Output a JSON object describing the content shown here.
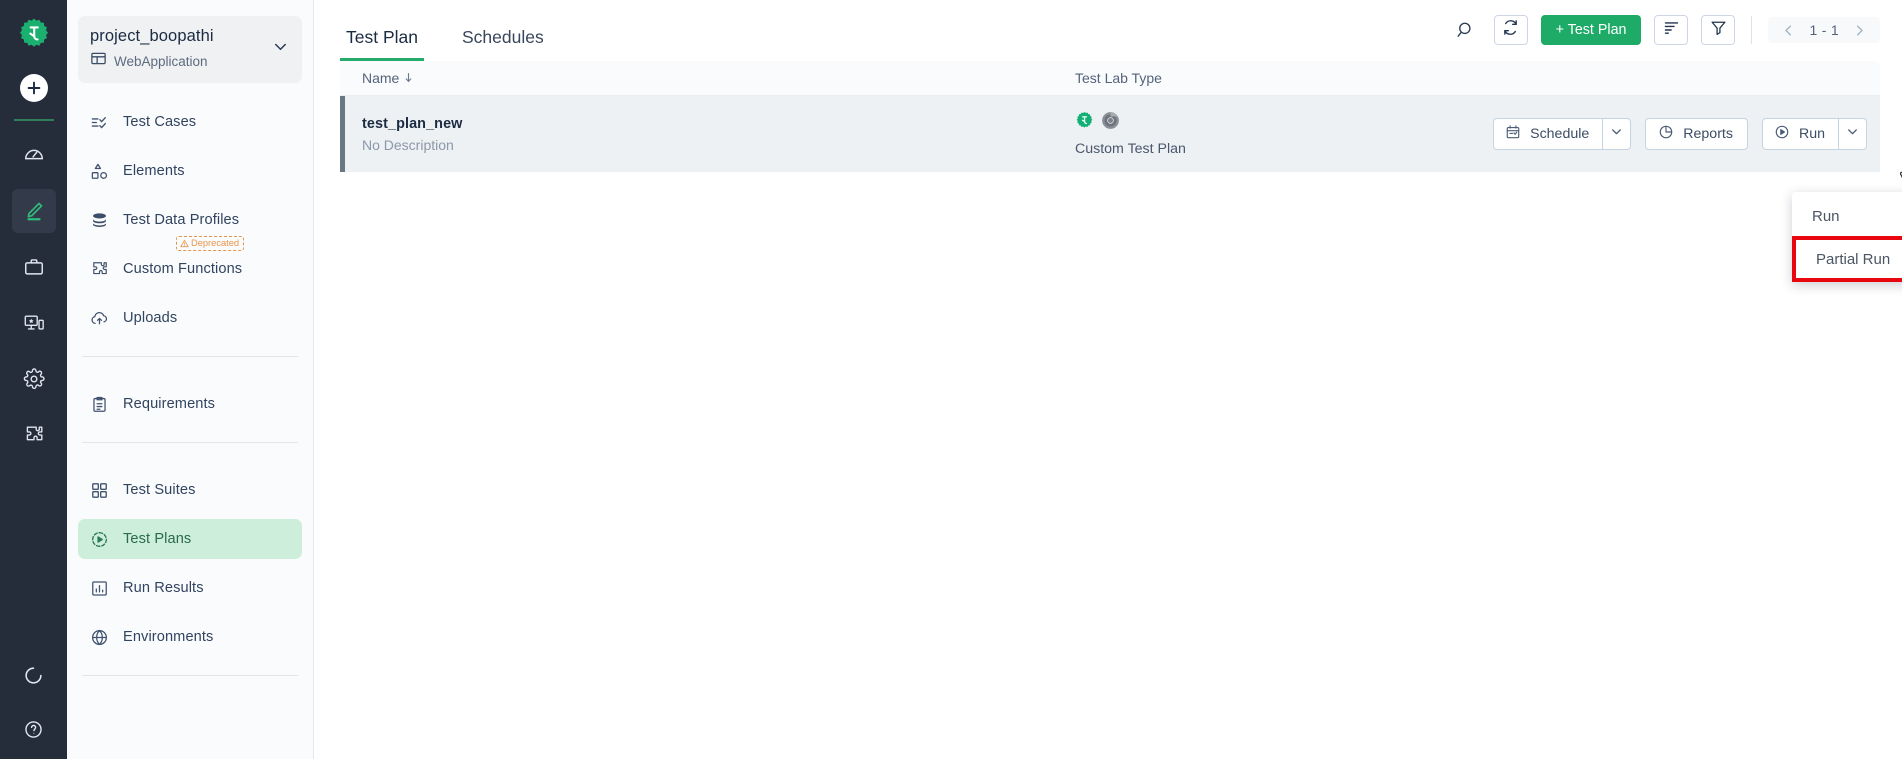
{
  "rail": {
    "logo": "testsigma-gear-logo",
    "add_label": "+",
    "items": [
      {
        "name": "dashboard-icon",
        "label": "Dashboard"
      },
      {
        "name": "create-edit-icon",
        "label": "Create",
        "active": true
      },
      {
        "name": "briefcase-icon",
        "label": "Projects"
      },
      {
        "name": "devices-icon",
        "label": "Test Labs"
      },
      {
        "name": "gear-icon",
        "label": "Settings"
      },
      {
        "name": "puzzle-icon",
        "label": "Addons"
      }
    ],
    "bottom_items": [
      {
        "name": "loading-circle-icon",
        "label": "Status"
      },
      {
        "name": "help-icon",
        "label": "Help"
      }
    ]
  },
  "sidebar": {
    "project": {
      "name": "project_boopathi",
      "type": "WebApplication",
      "type_icon": "web-application-icon",
      "chevron": "chevron-down-icon"
    },
    "groups": [
      {
        "items": [
          {
            "label": "Test Cases",
            "icon": "test-cases-icon",
            "active": false
          },
          {
            "label": "Elements",
            "icon": "elements-icon",
            "active": false
          },
          {
            "label": "Test Data Profiles",
            "icon": "database-icon",
            "active": false
          },
          {
            "label": "Custom Functions",
            "icon": "puzzle-icon",
            "active": false,
            "badge": "Deprecated"
          },
          {
            "label": "Uploads",
            "icon": "upload-cloud-icon",
            "active": false
          }
        ]
      },
      {
        "items": [
          {
            "label": "Requirements",
            "icon": "clipboard-icon",
            "active": false
          }
        ]
      },
      {
        "items": [
          {
            "label": "Test Suites",
            "icon": "grid-icon",
            "active": false
          },
          {
            "label": "Test Plans",
            "icon": "play-circle-icon",
            "active": true
          },
          {
            "label": "Run Results",
            "icon": "bar-chart-icon",
            "active": false
          },
          {
            "label": "Environments",
            "icon": "globe-icon",
            "active": false
          }
        ]
      }
    ]
  },
  "topbar": {
    "tabs": [
      {
        "label": "Test Plan",
        "active": true
      },
      {
        "label": "Schedules",
        "active": false
      }
    ],
    "search_icon": "search-icon",
    "refresh_icon": "refresh-icon",
    "create_button": "+ Test Plan",
    "sort_icon": "sort-icon",
    "filter_icon": "filter-icon",
    "pagination": {
      "prev_icon": "chevron-left-icon",
      "range": "1 - 1",
      "next_icon": "chevron-right-icon"
    }
  },
  "table": {
    "columns": [
      {
        "label": "Name",
        "sort_icon": "sort-arrow-icon"
      },
      {
        "label": "Test Lab Type"
      }
    ],
    "rows": [
      {
        "name": "test_plan_new",
        "description": "No Description",
        "lab_icons": [
          "testsigma-gear-icon",
          "chrome-icon"
        ],
        "lab_type": "Custom Test Plan",
        "actions": {
          "schedule": {
            "label": "Schedule",
            "icon": "calendar-icon",
            "caret": "chevron-down-icon"
          },
          "reports": {
            "label": "Reports",
            "icon": "pie-chart-icon"
          },
          "run": {
            "label": "Run",
            "icon": "play-circle-icon",
            "caret": "chevron-down-icon"
          }
        }
      }
    ]
  },
  "dropdown_menu": {
    "items": [
      {
        "label": "Run",
        "highlighted": false
      },
      {
        "label": "Partial Run",
        "highlighted": true
      }
    ],
    "highlight_color": "#e8070f"
  },
  "colors": {
    "accent_green": "#1eab68",
    "rail_bg": "#262d3a",
    "active_nav_bg": "#cdeeda",
    "row_bg": "#eef1f4",
    "row_accent": "#6b7684",
    "highlight_red": "#e8070f"
  }
}
